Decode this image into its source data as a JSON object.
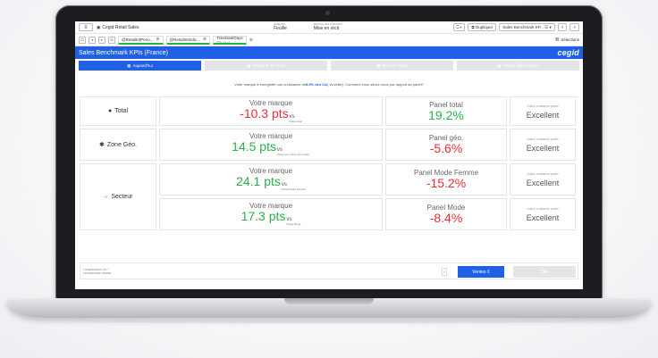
{
  "toolbar": {
    "menu_icon": "hamburger-icon",
    "app_name": "Cegid Retail Sales",
    "center": [
      {
        "label": "Analyser",
        "value": "Feuille"
      },
      {
        "label": "Aperçu des données",
        "value": "Mise en récit"
      }
    ],
    "duplicate_label": "Dupliquer",
    "sheet_name": "Sales Benchmark KP...",
    "nav_prev": "<",
    "nav_next": ">"
  },
  "selections": {
    "chips": [
      {
        "label": "@RetailIntPerio...",
        "sub": ""
      },
      {
        "label": "@RetailIntIndic...",
        "sub": ""
      },
      {
        "label": "TimeDateDays",
        "sub": "2022-10-11"
      }
    ],
    "right_label": "Sélections"
  },
  "header": {
    "title": "Sales Benchmark KPIs (France)",
    "logo": "cegid"
  },
  "tabs": [
    {
      "label": "Aujourd'hui",
      "active": true
    },
    {
      "label": "Semaine en cours",
      "active": false
    },
    {
      "label": "Mois en cours",
      "active": false
    },
    {
      "label": "Depuis début année",
      "active": false
    }
  ],
  "message": {
    "prefix": "Votre marque a enregistré une croissance de ",
    "highlight": "8.9% des CA",
    "suffix": " ( vs veille). Comment vous situez-vous par rapport au panel?"
  },
  "rows": [
    {
      "label": "Total",
      "icon": "globe-icon",
      "brand_title": "Votre marque",
      "brand_value": "-10.3 pts",
      "brand_color": "red",
      "vs": "vs",
      "vs_sub": "Panel total",
      "panel_title": "Panel total",
      "panel_value": "19.2%",
      "panel_color": "green",
      "conf_title": "Indice confiance panel",
      "conf_value": "Excellent"
    },
    {
      "label": "Zone Géo.",
      "icon": "map-icon",
      "brand_title": "Votre marque",
      "brand_value": "14.5 pts",
      "brand_color": "green",
      "vs": "vs",
      "vs_sub": "Panel sur même Zone Géo.",
      "panel_title": "Panel géo.",
      "panel_value": "-5.6%",
      "panel_color": "red",
      "conf_title": "Indice confiance panel",
      "conf_value": "Excellent"
    },
    {
      "label": "Secteur",
      "icon": "sector-icon",
      "brand_title": "Votre marque",
      "brand_value": "24.1 pts",
      "brand_color": "green",
      "vs": "vs",
      "vs_sub": "Panel Mode Femme",
      "panel_title": "Panel Mode Femme",
      "panel_value": "-15.2%",
      "panel_color": "red",
      "conf_title": "Indice confiance panel",
      "conf_value": "Excellent"
    },
    {
      "label": "",
      "icon": "",
      "brand_title": "Votre marque",
      "brand_value": "17.3 pts",
      "brand_color": "green",
      "vs": "vs",
      "vs_sub": "Panel Mode",
      "panel_title": "Panel Mode",
      "panel_value": "-8.4%",
      "panel_color": "red",
      "conf_title": "Indice confiance panel",
      "conf_value": "Excellent"
    }
  ],
  "footer": {
    "note_line1": "Comparaison du /",
    "note_line2": "commerciale depuis",
    "ventes_label": "Ventes €",
    "qty_label": "Qté"
  },
  "colors": {
    "brand_blue": "#1f60e6",
    "red": "#e5313b",
    "green": "#2ab04a"
  }
}
